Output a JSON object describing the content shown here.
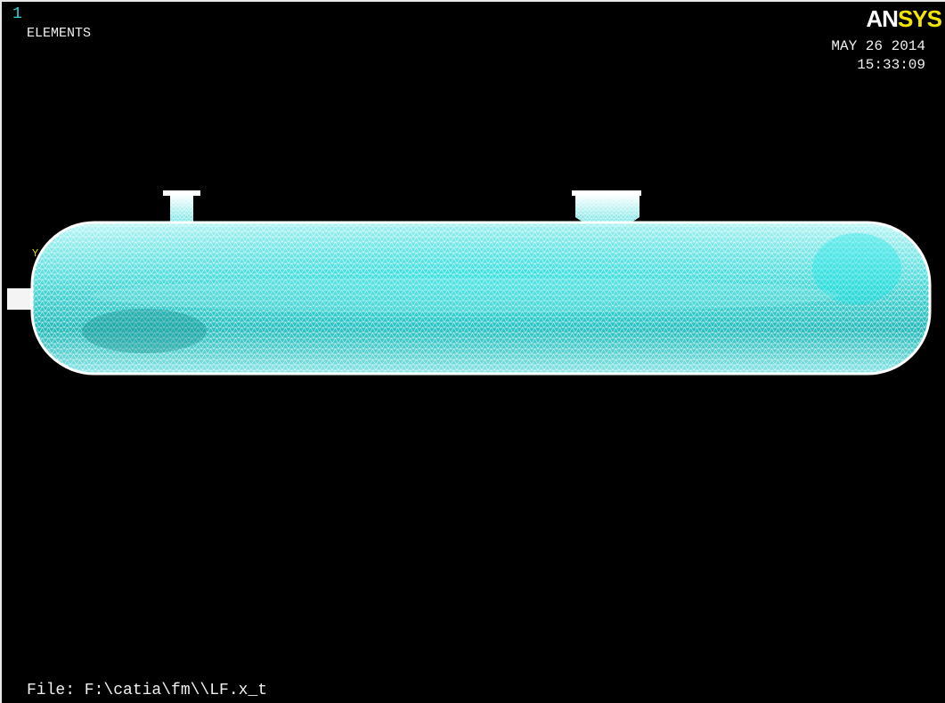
{
  "viewport": {
    "window_number": "1",
    "plot_label": "ELEMENTS",
    "date": "MAY 26 2014",
    "time": "15:33:09",
    "file_label": "File: F:\\catia\\fm\\\\LF.x_t"
  },
  "logo": {
    "part1": "AN",
    "part2": "SYS"
  },
  "triad": {
    "axis_label": "Y"
  },
  "colors": {
    "background": "#000000",
    "mesh_fill": "#2fcfcf",
    "mesh_line": "#ffffff",
    "logo_sys": "#f2e600",
    "window_number": "#2fd6d6"
  },
  "icons": {
    "triad": "coordinate-triad-icon",
    "mesh": "finite-element-mesh"
  }
}
